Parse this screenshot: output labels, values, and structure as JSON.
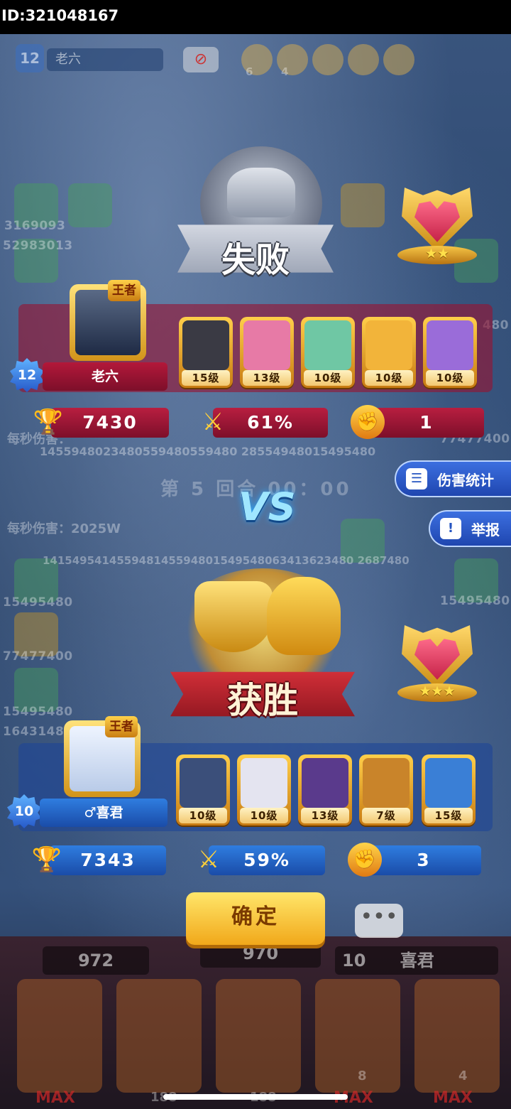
{
  "status_bar": {
    "id_text": "ID:321048167"
  },
  "background": {
    "top_level": "12",
    "top_name": "老六",
    "mute_icon": "no-sound-icon",
    "face_counts": [
      "6",
      "4"
    ],
    "left_numbers": [
      "3169093",
      "52983013",
      "15495480",
      "77477400",
      "15495480",
      "1643148"
    ],
    "right_numbers": [
      "480",
      "77477400",
      "15495480"
    ],
    "dps_top": "每秒伤害：",
    "dps_bottom": "每秒伤害：2025W",
    "damage_row_top": "1455948023480559480559480 28554948015495480",
    "damage_row_bottom": "141549541455948145594801549548063413623480 2687480",
    "round_text": "第 5 回合 00：00",
    "bottom_coin_left": "972",
    "bottom_coin_mid": "970",
    "bottom_level": "10",
    "bottom_name": "喜君",
    "bottom_max": "MAX",
    "bottom_card_nums": [
      "8",
      "4"
    ],
    "bottom_small_counts": [
      "188",
      "188"
    ]
  },
  "loser": {
    "result_label": "失败",
    "trophy_stars": "★★",
    "crown_tag": "王者",
    "level": "12",
    "name": "老六",
    "cards": [
      {
        "level": "15级",
        "color": "#3a3a44"
      },
      {
        "level": "13级",
        "color": "#e77aa6"
      },
      {
        "level": "10级",
        "color": "#6fc7a4"
      },
      {
        "level": "10级",
        "color": "#f2b43a"
      },
      {
        "level": "10级",
        "color": "#9a6cd9"
      }
    ],
    "trophies": "7430",
    "win_rate": "61%",
    "power": "1"
  },
  "winner": {
    "result_label": "获胜",
    "trophy_stars": "★★★",
    "crown_tag": "王者",
    "level": "10",
    "name": "♂喜君",
    "cards": [
      {
        "level": "10级",
        "color": "#3b4f7a"
      },
      {
        "level": "10级",
        "color": "#e4e4f0"
      },
      {
        "level": "13级",
        "color": "#5a3a8c"
      },
      {
        "level": "7级",
        "color": "#c9842a"
      },
      {
        "level": "15级",
        "color": "#3a7fd6"
      }
    ],
    "trophies": "7343",
    "win_rate": "59%",
    "power": "3"
  },
  "vs_label": "VS",
  "buttons": {
    "damage_stats": "伤害统计",
    "report": "举报",
    "confirm": "确定"
  },
  "colors": {
    "lose_panel": "#96143280",
    "win_panel": "#1e4696",
    "accent_gold": "#f1a81a"
  }
}
